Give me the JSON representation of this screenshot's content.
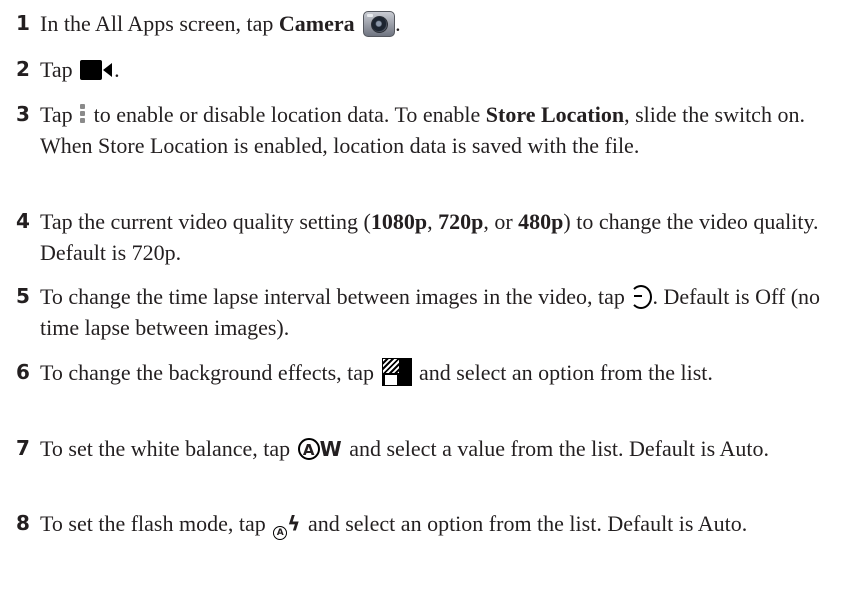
{
  "steps": [
    {
      "num": "1",
      "t1": "In the All Apps screen, tap ",
      "b1": "Camera",
      "t2": " "
    },
    {
      "num": "2",
      "t1": "Tap ",
      "t2": "."
    },
    {
      "num": "3",
      "t1": "Tap ",
      "t2": " to enable or disable location data. To enable ",
      "b1": "Store Location",
      "t3": ", slide the switch on. When Store Location is enabled, location data is saved with the file."
    },
    {
      "num": "4",
      "t1": "Tap the current video quality setting (",
      "b1": "1080p",
      "t2": ", ",
      "b2": "720p",
      "t3": ", or ",
      "b3": "480p",
      "t4": ") to change the video quality. Default is 720p."
    },
    {
      "num": "5",
      "t1": "To change the time lapse interval between images in the video, tap ",
      "t2": ". Default is Off (no time lapse between images)."
    },
    {
      "num": "6",
      "t1": "To change the background effects, tap ",
      "t2": " and select an option from the list."
    },
    {
      "num": "7",
      "t1": "To set the white balance, tap ",
      "t2": " and select a value from the list. Default is Auto."
    },
    {
      "num": "8",
      "t1": "To set the flash mode, tap ",
      "t2": " and select an option from the list. Default is Auto."
    }
  ],
  "icons": {
    "camera": "camera-app-icon",
    "video": "video-camera-icon",
    "menu": "vertical-ellipsis-icon",
    "timelapse": "time-lapse-icon",
    "effects": "background-effects-icon",
    "whitebalance": {
      "name": "white-balance-icon",
      "circle": "A",
      "letter": "W"
    },
    "flash": {
      "name": "flash-mode-icon",
      "circle": "A",
      "bolt": "ϟ"
    }
  }
}
